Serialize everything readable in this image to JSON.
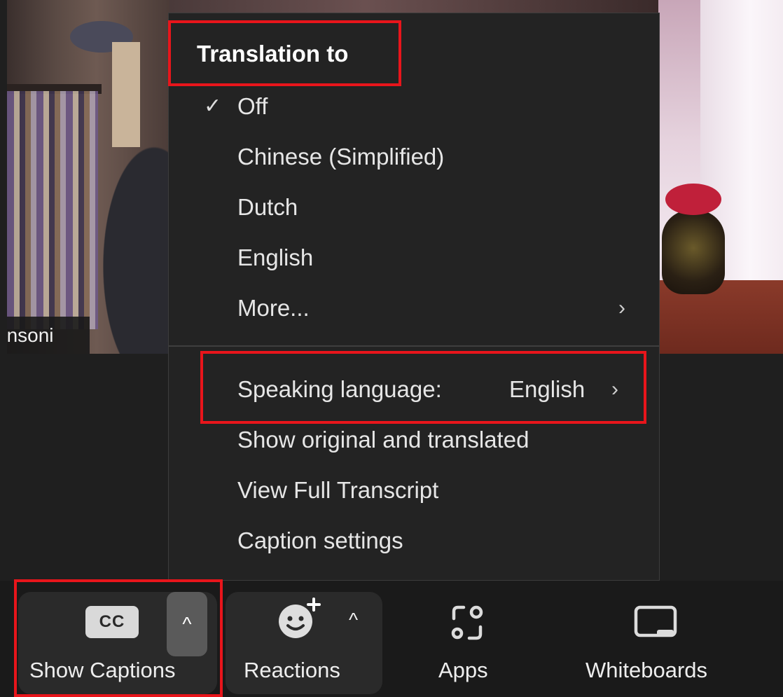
{
  "video": {
    "participant_name": "onsoni"
  },
  "menu": {
    "title": "Translation to",
    "check_glyph": "✓",
    "submenu_glyph": "›",
    "items": [
      {
        "label": "Off",
        "checked": true
      },
      {
        "label": "Chinese (Simplified)",
        "checked": false
      },
      {
        "label": "Dutch",
        "checked": false
      },
      {
        "label": "English",
        "checked": false
      },
      {
        "label": "More...",
        "checked": false,
        "has_submenu": true
      }
    ],
    "speaking_language": {
      "label": "Speaking language:",
      "value": "English",
      "has_submenu": true
    },
    "actions": [
      {
        "label": "Show original and translated"
      },
      {
        "label": "View Full Transcript"
      },
      {
        "label": "Caption settings"
      }
    ]
  },
  "toolbar": {
    "captions": {
      "label": "Show Captions",
      "icon": "cc-icon",
      "icon_text": "CC",
      "caret": "^"
    },
    "reactions": {
      "label": "Reactions",
      "icon": "smiley-plus-icon",
      "caret": "^"
    },
    "apps": {
      "label": "Apps",
      "icon": "apps-icon"
    },
    "whiteboards": {
      "label": "Whiteboards",
      "icon": "whiteboard-icon"
    }
  },
  "colors": {
    "highlight": "#e8151b",
    "menu_background": "#232323",
    "toolbar_background": "#1a1a1a"
  }
}
